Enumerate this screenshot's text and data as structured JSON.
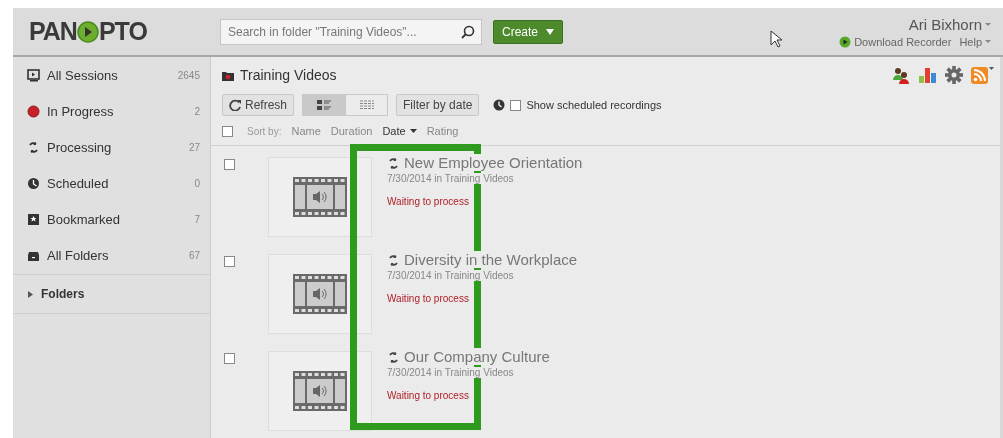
{
  "header": {
    "logo": {
      "left": "PAN",
      "right": "PTO"
    },
    "search": {
      "placeholder": "Search in folder \"Training Videos\"..."
    },
    "create_button": "Create",
    "user": "Ari Bixhorn",
    "download_recorder": "Download Recorder",
    "help": "Help"
  },
  "sidebar": {
    "items": [
      {
        "label": "All Sessions",
        "count": "2645"
      },
      {
        "label": "In Progress",
        "count": "2"
      },
      {
        "label": "Processing",
        "count": "27"
      },
      {
        "label": "Scheduled",
        "count": "0"
      },
      {
        "label": "Bookmarked",
        "count": "7"
      },
      {
        "label": "All Folders",
        "count": "67"
      }
    ],
    "folders": {
      "label": "Folders",
      "expanded": false
    }
  },
  "main": {
    "folder_title": "Training Videos",
    "toolbar": {
      "refresh": "Refresh",
      "views": [
        {
          "selected": true
        },
        {
          "selected": false
        }
      ],
      "filter": "Filter by date",
      "show_scheduled": {
        "label": "Show scheduled recordings",
        "checked": false
      }
    },
    "sort": {
      "label": "Sort by:",
      "select_all_checked": false,
      "options": [
        {
          "label": "Name",
          "selected": false
        },
        {
          "label": "Duration",
          "selected": false
        },
        {
          "label": "Date",
          "selected": true
        },
        {
          "label": "Rating",
          "selected": false
        }
      ]
    },
    "sessions": [
      {
        "title": "New Employee Orientation",
        "meta": "7/30/2014 in Training Videos",
        "status": "Waiting to process",
        "checked": false
      },
      {
        "title": "Diversity in the Workplace",
        "meta": "7/30/2014 in Training Videos",
        "status": "Waiting to process",
        "checked": false
      },
      {
        "title": "Our Company Culture",
        "meta": "7/30/2014 in Training Videos",
        "status": "Waiting to process",
        "checked": false
      }
    ]
  }
}
